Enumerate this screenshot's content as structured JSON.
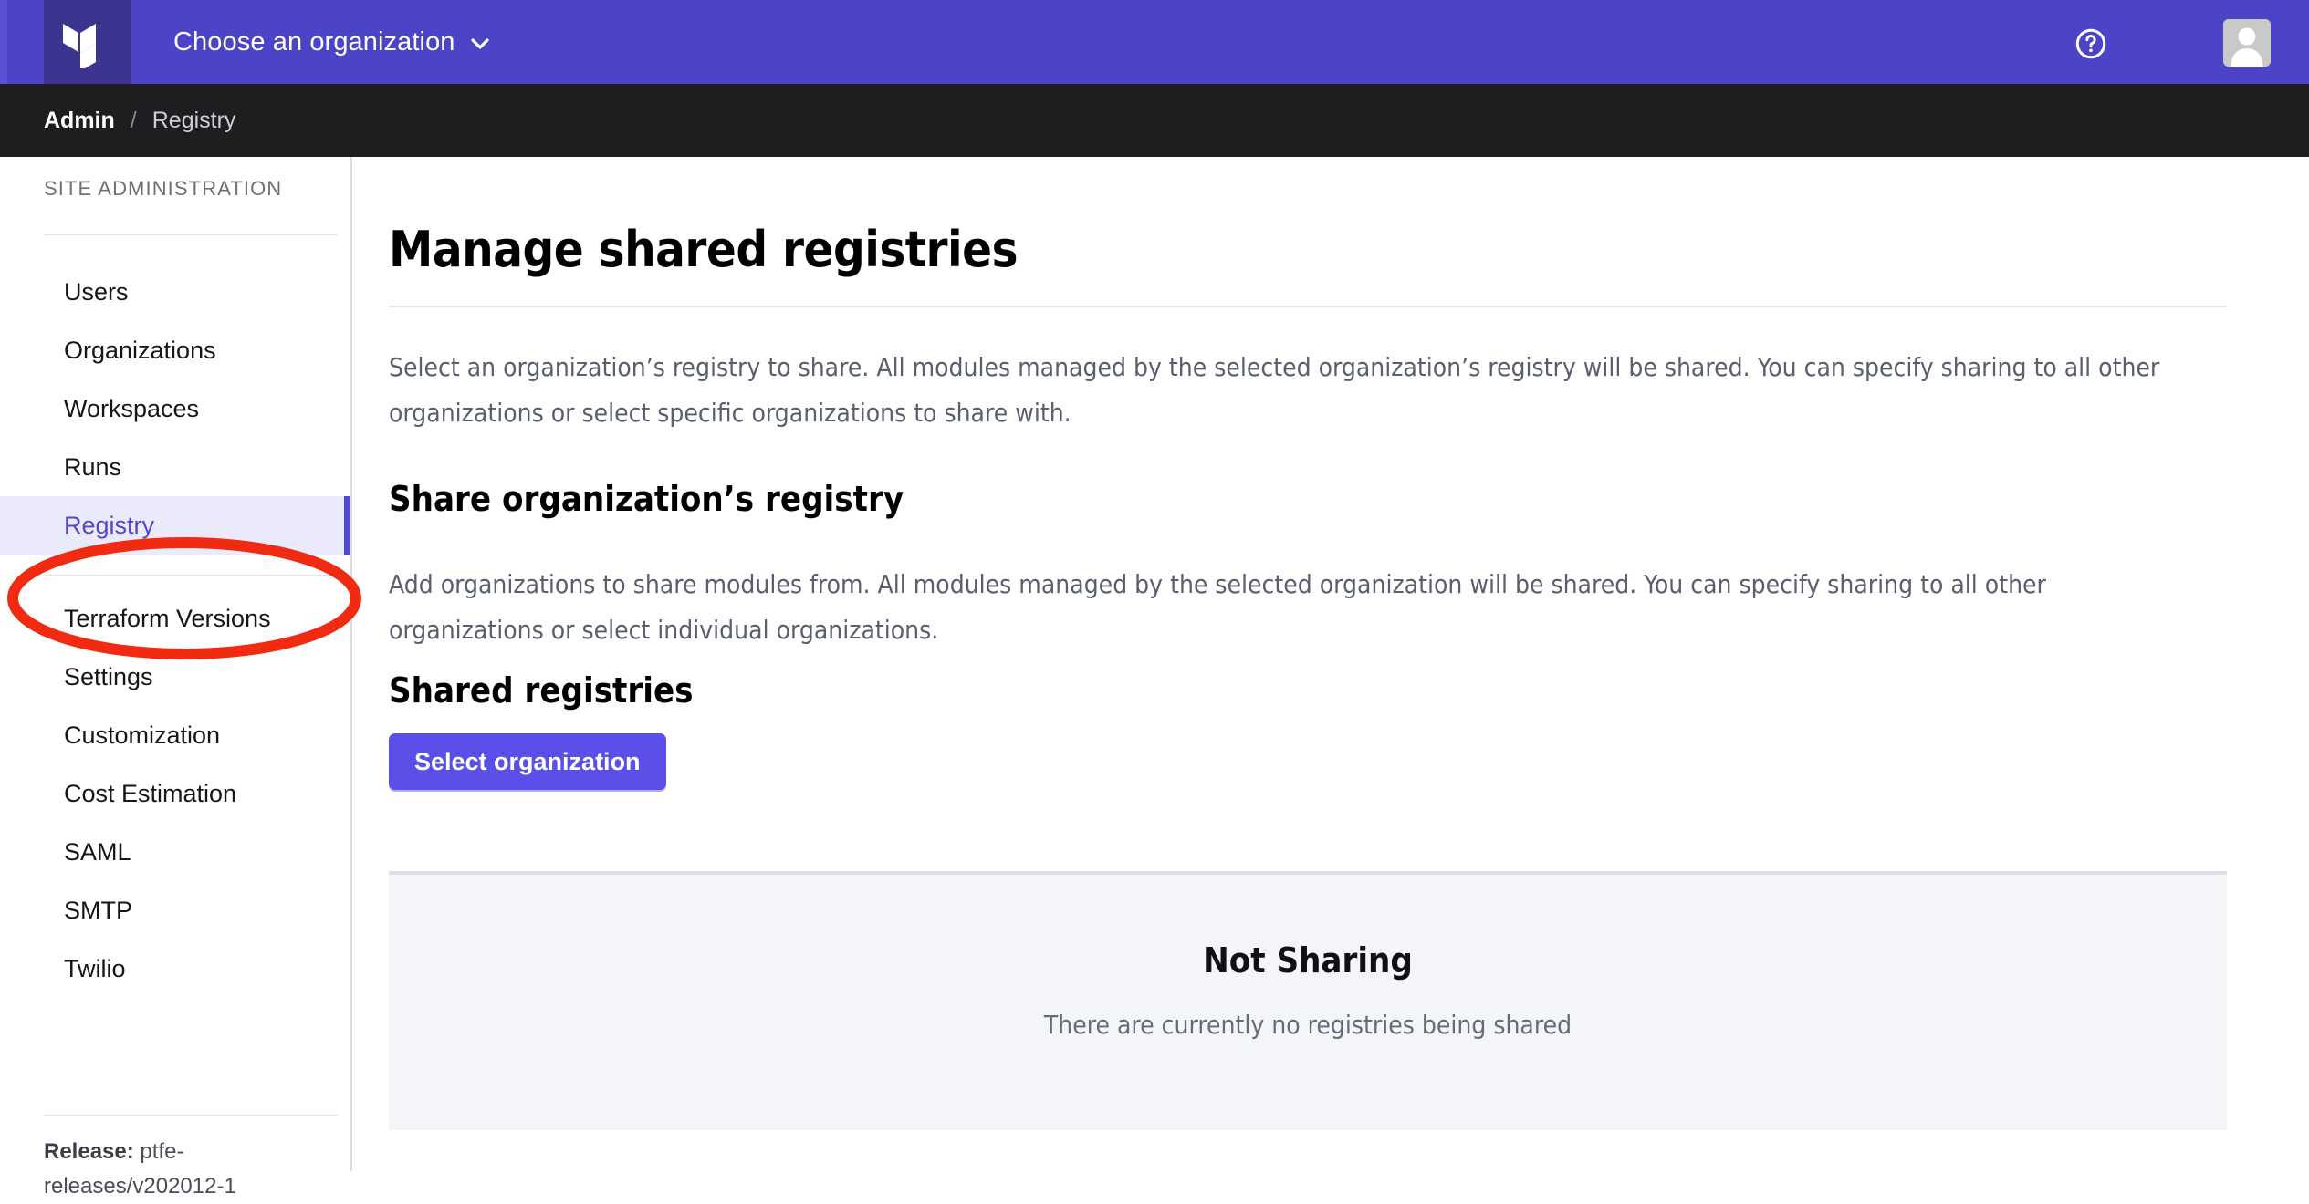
{
  "topbar": {
    "logo_icon": "terraform-logo-icon",
    "org_chooser_label": "Choose an organization",
    "chevron_icon": "chevron-down-icon",
    "help_icon": "help-circle-icon",
    "avatar_icon": "user-avatar-icon",
    "background_color": "#4c44c6",
    "logo_tile_color": "#3c3590"
  },
  "breadcrumb": {
    "root": "Admin",
    "separator": "/",
    "current": "Registry",
    "background_color": "#1e1e20"
  },
  "sidebar": {
    "section_title": "SITE ADMINISTRATION",
    "items": [
      {
        "label": "Users",
        "active": false
      },
      {
        "label": "Organizations",
        "active": false
      },
      {
        "label": "Workspaces",
        "active": false
      },
      {
        "label": "Runs",
        "active": false
      },
      {
        "label": "Registry",
        "active": true
      },
      {
        "label": "Terraform Versions",
        "active": false
      },
      {
        "label": "Settings",
        "active": false
      },
      {
        "label": "Customization",
        "active": false
      },
      {
        "label": "Cost Estimation",
        "active": false
      },
      {
        "label": "SAML",
        "active": false
      },
      {
        "label": "SMTP",
        "active": false
      },
      {
        "label": "Twilio",
        "active": false
      }
    ],
    "release_label": "Release:",
    "release_value": "ptfe-releases/v202012-1",
    "active_color": "#5147d5",
    "active_background": "#ebeafa"
  },
  "main": {
    "page_title": "Manage shared registries",
    "intro_paragraph": "Select an organization’s registry to share. All modules managed by the selected organization’s registry will be shared. You can specify sharing to all other organizations or select specific organizations to share with.",
    "share_section": {
      "heading": "Share organization’s registry",
      "paragraph": "Add organizations to share modules from. All modules managed by the selected organization will be shared. You can specify sharing to all other organizations or select individual organizations.",
      "button_label": "Select organization",
      "button_color": "#5a4fe8"
    },
    "shared_section": {
      "heading": "Shared registries",
      "empty_title": "Not Sharing",
      "empty_subtitle": "There are currently no registries being shared",
      "panel_background": "#f4f5f8"
    }
  },
  "annotation": {
    "shape": "ellipse",
    "target": "Registry",
    "color": "#f02b11"
  }
}
